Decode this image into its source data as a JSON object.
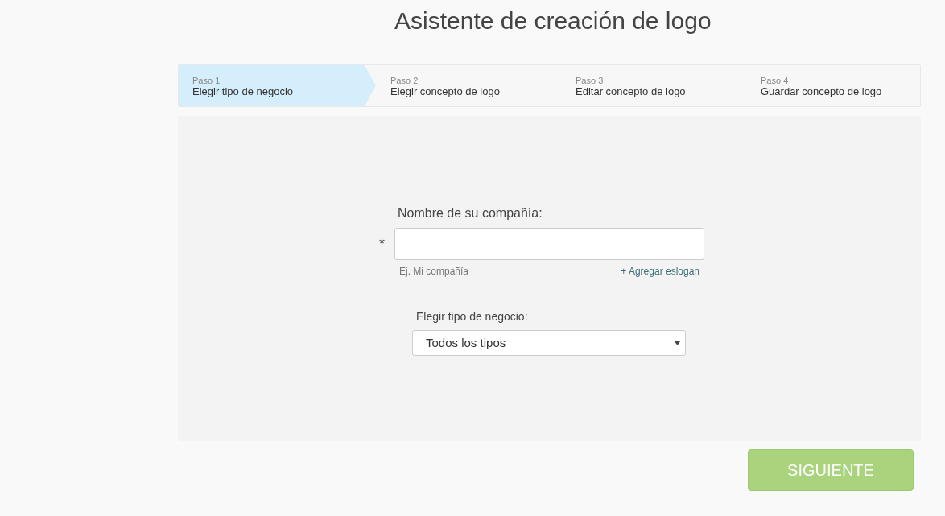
{
  "title": "Asistente de creación de logo",
  "steps": [
    {
      "number": "Paso 1",
      "label": "Elegir tipo de negocio",
      "selected": true
    },
    {
      "number": "Paso 2",
      "label": "Elegir concepto de logo",
      "selected": false
    },
    {
      "number": "Paso 3",
      "label": "Editar concepto de logo",
      "selected": false
    },
    {
      "number": "Paso 4",
      "label": "Guardar concepto de logo",
      "selected": false
    }
  ],
  "company_field": {
    "label": "Nombre de su compañía:",
    "required_mark": "*",
    "hint": "Ej. Mi compañía",
    "link": "+ Agregar eslogan"
  },
  "business_type": {
    "label": "Elegir tipo de negocio:",
    "value": "Todos los tipos"
  },
  "next_button": "SIGUIENTE"
}
